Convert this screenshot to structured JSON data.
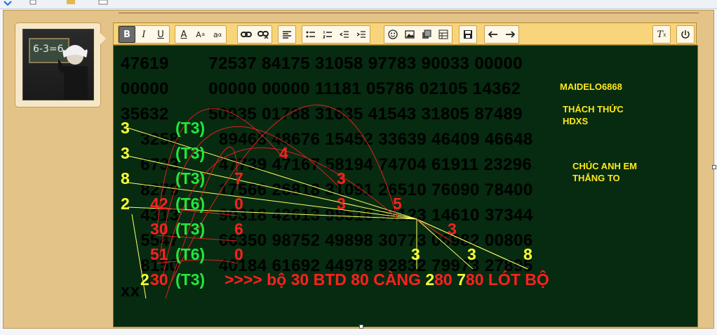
{
  "colors": {
    "panel": "#e3c387",
    "toolbar": "#f8d57a",
    "editor_bg": "#062b10",
    "yellow": "#ffff33",
    "red": "#ff2020",
    "green": "#22e63c",
    "line_yellow": "#ffff66",
    "line_red": "#e02020"
  },
  "toolbar": {
    "groups": [
      [
        "bold-icon",
        "italic-icon",
        "underline-icon"
      ],
      [
        "text-color-icon",
        "font-size-icon",
        "font-case-icon"
      ],
      [
        "link-icon",
        "unlink-icon"
      ],
      [
        "align-left-icon"
      ],
      [
        "bulleted-list-icon",
        "numbered-list-icon",
        "outdent-icon",
        "indent-icon"
      ],
      [
        "emoji-icon",
        "image-icon",
        "media-icon",
        "table-icon"
      ],
      [
        "save-icon"
      ],
      [
        "undo-icon",
        "redo-icon"
      ],
      [
        "clear-format-icon"
      ],
      [
        "source-icon"
      ]
    ]
  },
  "grid_rows": [
    "47619        72537 84175 31058 97783 90033 00000",
    "00000        00000 00000 11181 05786 02105 14362",
    "35632        50935 01788 31635 41543 31805 87489",
    "    3258        89468 48676 15452 33639 46409 46648",
    "    6733        47739 47167 58194 74704 61911 23296",
    "    8279        17566 26818 31091 26510 76090 78400",
    "    4313        90318 42613 98518 54123 14610 37344",
    "    5547        66350 98752 49898 30773 06982 00806",
    "    8150        40184 61692 44978 92832 79973 27895",
    "xx"
  ],
  "marks": {
    "left_nums": [
      "3",
      "3",
      "8",
      "2",
      "",
      "",
      ""
    ],
    "red_nums": [
      "",
      "",
      "",
      "42",
      "30",
      "51",
      "30"
    ],
    "green_labels": [
      "(T3)",
      "(T3)",
      "(T3)",
      "(T6)",
      "(T3)",
      "(T6)",
      "(T3)"
    ],
    "inline_red": [
      "4",
      "3",
      "7",
      "3",
      "0",
      "5",
      "6",
      "3",
      "0"
    ],
    "inline_yellow": [
      "3",
      "3",
      "8"
    ],
    "bottom_left_yellow": "2",
    "bottom_text": [
      ">>>> bộ 30 BTD 80 CÀNG ",
      "2",
      "80 ",
      "7",
      "80 LÓT BỘ"
    ]
  },
  "side": {
    "name": "MAIDELO6868",
    "challenge": [
      "THÁCH THỨC",
      "HDXS"
    ],
    "wish": [
      "CHÚC ANH EM",
      "THẮNG TO"
    ]
  },
  "avatar": {
    "board_text": "6-3=6"
  }
}
